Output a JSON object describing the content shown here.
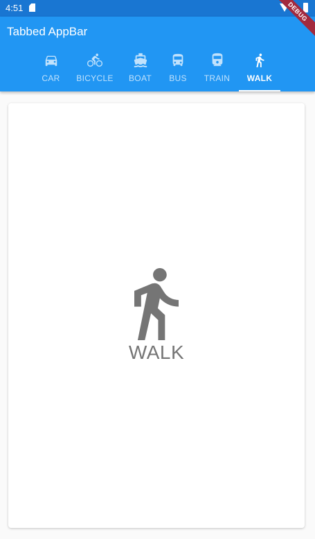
{
  "status_bar": {
    "time": "4:51",
    "color": "#1976d2"
  },
  "debug_banner": {
    "label": "DEBUG"
  },
  "app_bar": {
    "title": "Tabbed AppBar",
    "color": "#2196f3"
  },
  "tabs": [
    {
      "label": "CAR",
      "icon": "car-icon",
      "selected": false
    },
    {
      "label": "BICYCLE",
      "icon": "bicycle-icon",
      "selected": false
    },
    {
      "label": "BOAT",
      "icon": "boat-icon",
      "selected": false
    },
    {
      "label": "BUS",
      "icon": "bus-icon",
      "selected": false
    },
    {
      "label": "TRAIN",
      "icon": "train-icon",
      "selected": false
    },
    {
      "label": "WALK",
      "icon": "walk-icon",
      "selected": true
    }
  ],
  "content": {
    "icon": "walk-icon",
    "label": "WALK",
    "color": "#757575"
  }
}
